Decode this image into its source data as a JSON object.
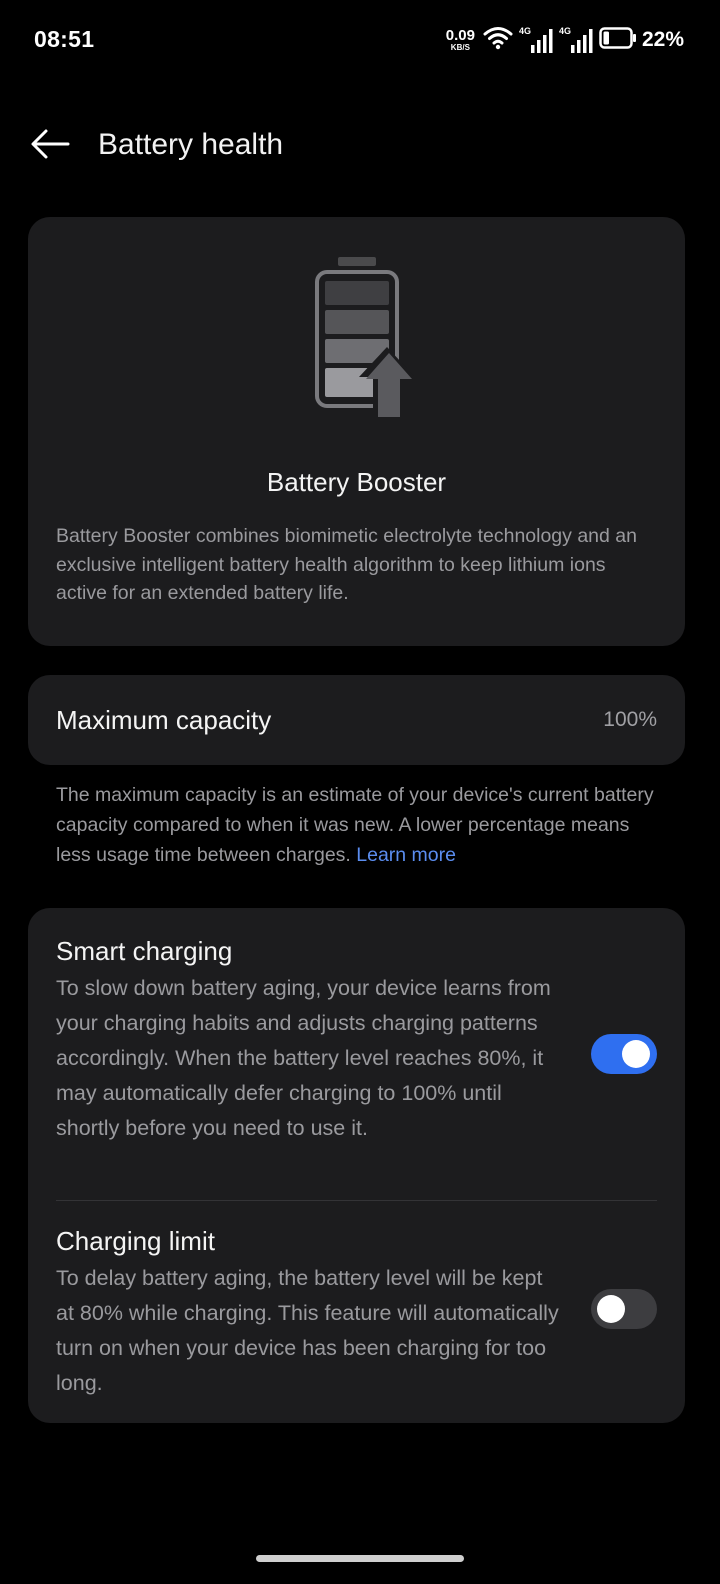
{
  "status_bar": {
    "time": "08:51",
    "net_speed_value": "0.09",
    "net_speed_unit": "KB/S",
    "sim1_label": "4G",
    "sim2_label": "4G",
    "battery_percent": "22%",
    "battery_level": 0.22
  },
  "header": {
    "title": "Battery health"
  },
  "booster": {
    "title": "Battery Booster",
    "description": "Battery Booster combines biomimetic electrolyte technology and an exclusive intelligent battery health algorithm to keep lithium ions active for an extended battery life."
  },
  "capacity": {
    "label": "Maximum capacity",
    "value": "100%",
    "note": "The maximum capacity is an estimate of your device's current battery capacity compared to when it was new. A lower percentage means less usage time between charges.",
    "learn_more": "Learn more"
  },
  "smart_charging": {
    "title": "Smart charging",
    "description": "To slow down battery aging, your device learns from your charging habits and adjusts charging patterns accordingly. When the battery level reaches 80%, it may automatically defer charging to 100% until shortly before you need to use it.",
    "enabled": true
  },
  "charging_limit": {
    "title": "Charging limit",
    "description": "To delay battery aging, the battery level will be kept at 80% while charging. This feature will automatically turn on when your device has been charging for too long.",
    "enabled": false
  },
  "colors": {
    "background": "#000000",
    "card": "#1c1c1e",
    "accent": "#2f6ff0",
    "link": "#5b8def",
    "secondary_text": "#9a9a9e"
  }
}
